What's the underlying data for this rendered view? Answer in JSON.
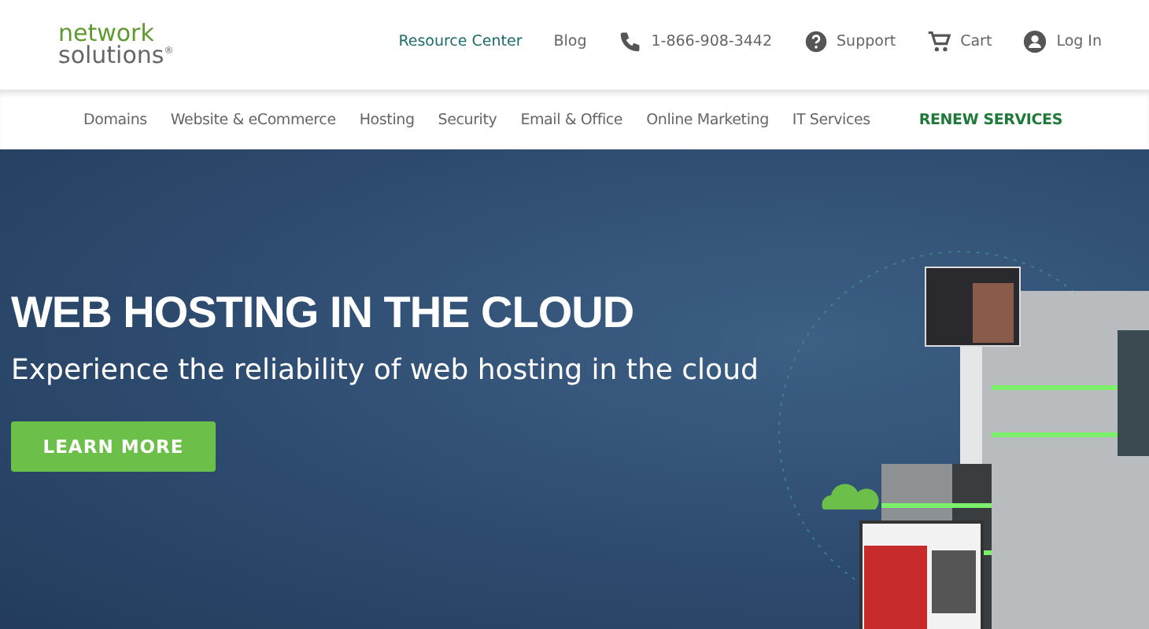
{
  "logo": {
    "line_1": "network",
    "line_2": "solutions$^{®}$"
  },
  "top_links": [
    {
      "label": "Resource Center",
      "kind": "featured"
    },
    {
      "label": "Blog",
      "kind": "plain"
    },
    {
      "label": "1-866-908-3442",
      "kind": "phone"
    },
    {
      "label": "Support",
      "kind": "help"
    },
    {
      "label": "Cart",
      "kind": "cart"
    },
    {
      "label": "Log In",
      "kind": "account"
    }
  ],
  "nav": [
    {
      "label": "Domains",
      "kind": "plain"
    },
    {
      "label": "Website & eCommerce",
      "kind": "plain"
    },
    {
      "label": "Hosting",
      "kind": "plain"
    },
    {
      "label": "Security",
      "kind": "plain"
    },
    {
      "label": "Email & Office",
      "kind": "plain"
    },
    {
      "label": "Online Marketing",
      "kind": "plain"
    },
    {
      "label": "IT Services",
      "kind": "plain"
    },
    {
      "label": "RENEW SERVICES",
      "kind": "highlight"
    }
  ],
  "hero": {
    "title": "WEB HOSTING IN THE CLOUD",
    "subtitle": "Experience the reliability of web hosting in the cloud",
    "button": "LEARN MORE"
  }
}
